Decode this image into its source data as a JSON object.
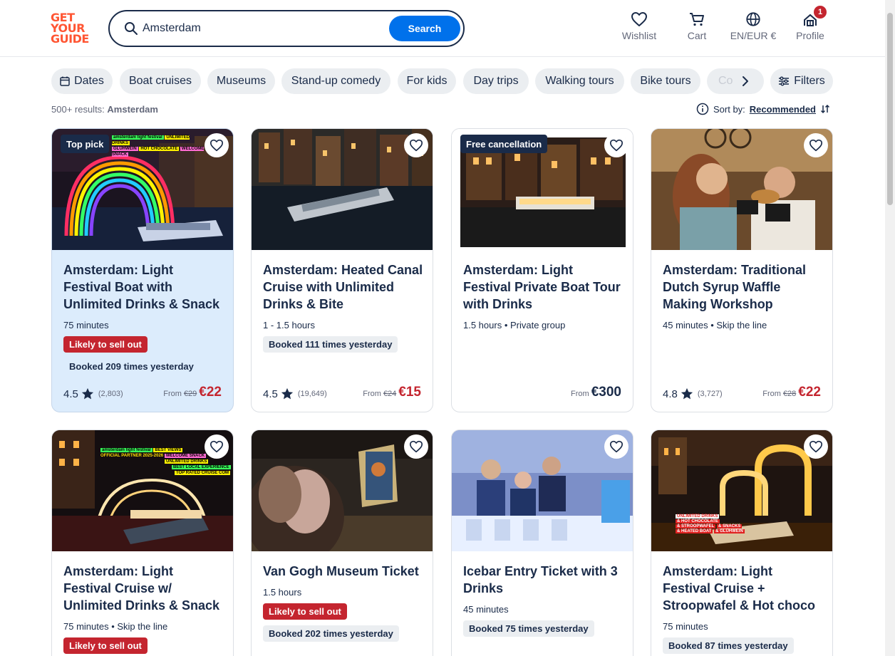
{
  "brand": {
    "line1": "GET",
    "line2": "YOUR",
    "line3": "GUIDE"
  },
  "search": {
    "value": "Amsterdam",
    "button_label": "Search"
  },
  "nav": {
    "wishlist": "Wishlist",
    "cart": "Cart",
    "currency": "EN/EUR €",
    "profile": "Profile",
    "profile_badge": "1"
  },
  "filters": {
    "chips": [
      "Dates",
      "Boat cruises",
      "Museums",
      "Stand-up comedy",
      "For kids",
      "Day trips",
      "Walking tours",
      "Bike tours",
      "Co"
    ],
    "filters_label": "Filters"
  },
  "results": {
    "count": "500+ results:",
    "query": "Amsterdam"
  },
  "sort": {
    "label": "Sort by:",
    "value": "Recommended"
  },
  "cards": [
    {
      "tag": "Top pick",
      "title": "Amsterdam: Light Festival Boat with Unlimited Drinks & Snack",
      "meta": "75 minutes",
      "alert": "Likely to sell out",
      "booked": "Booked 209 times yesterday",
      "rating": "4.5",
      "reviews": "(2,803)",
      "from": "From",
      "old_price": "€29",
      "price": "€22"
    },
    {
      "tag": "",
      "title": "Amsterdam: Heated Canal Cruise with Unlimited Drinks & Bite",
      "meta": "1 - 1.5 hours",
      "alert": "",
      "booked": "Booked 111 times yesterday",
      "rating": "4.5",
      "reviews": "(19,649)",
      "from": "From",
      "old_price": "€24",
      "price": "€15"
    },
    {
      "tag": "Free cancellation",
      "title": "Amsterdam: Light Festival Private Boat Tour with Drinks",
      "meta": "1.5 hours • Private group",
      "alert": "",
      "booked": "",
      "rating": "",
      "reviews": "",
      "from": "From",
      "old_price": "",
      "price": "€300"
    },
    {
      "tag": "",
      "title": "Amsterdam: Traditional Dutch Syrup Waffle Making Workshop",
      "meta": "45 minutes • Skip the line",
      "alert": "",
      "booked": "",
      "rating": "4.8",
      "reviews": "(3,727)",
      "from": "From",
      "old_price": "€28",
      "price": "€22"
    },
    {
      "tag": "",
      "title": "Amsterdam: Light Festival Cruise w/ Unlimited Drinks & Snack",
      "meta": "75 minutes • Skip the line",
      "alert": "Likely to sell out",
      "booked": ""
    },
    {
      "tag": "",
      "title": "Van Gogh Museum Ticket",
      "meta": "1.5 hours",
      "alert": "Likely to sell out",
      "booked": "Booked 202 times yesterday"
    },
    {
      "tag": "",
      "title": "Icebar Entry Ticket with 3 Drinks",
      "meta": "45 minutes",
      "alert": "",
      "booked": "Booked 75 times yesterday"
    },
    {
      "tag": "",
      "title": "Amsterdam: Light Festival Cruise + Stroopwafel & Hot choco",
      "meta": "75 minutes",
      "alert": "",
      "booked": "Booked 87 times yesterday"
    }
  ],
  "image_text": {
    "c1": [
      "UNLIMITED DRINKS",
      "GLÜHWEIN",
      "HOT CHOCOLATE",
      "WELCOME SNACK",
      "amsterdam light festival"
    ],
    "c5": [
      "BEST VIEWS",
      "WELCOME SNACK",
      "UNLIMITED DRINKS",
      "BEST LOCAL EXPERIENCE",
      "TOP RATED CRUISE COM",
      "amsterdam light festival",
      "OFFICIAL PARTNER 2025-2026"
    ],
    "c8": [
      "UNLIMITED DRINKS",
      "& HOT CHOCOLATE",
      "& STROOPWAFEL",
      "& SNACKS",
      "& GLÜHWEIN",
      "& HEATED BOAT"
    ]
  },
  "colors": {
    "brand": "#ff5533",
    "primary": "#0071eb",
    "danger": "#c4252f",
    "text": "#1a2b49",
    "highlight": "#dcecfc"
  }
}
